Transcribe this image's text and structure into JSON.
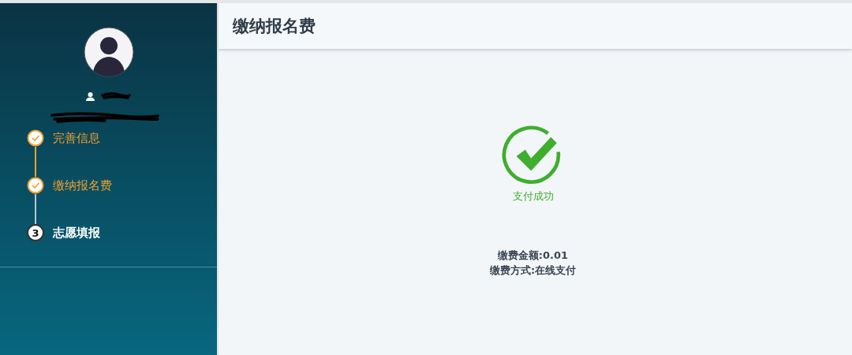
{
  "sidebar": {
    "steps": [
      {
        "label": "完善信息",
        "completed": true,
        "current": false
      },
      {
        "label": "缴纳报名费",
        "completed": true,
        "current": false
      },
      {
        "label": "志愿填报",
        "completed": false,
        "current": true,
        "number": "3"
      }
    ]
  },
  "header": {
    "title": "缴纳报名费"
  },
  "result": {
    "success": true,
    "message": "支付成功",
    "details": [
      "缴费金额:0.01",
      "缴费方式:在线支付"
    ]
  }
}
